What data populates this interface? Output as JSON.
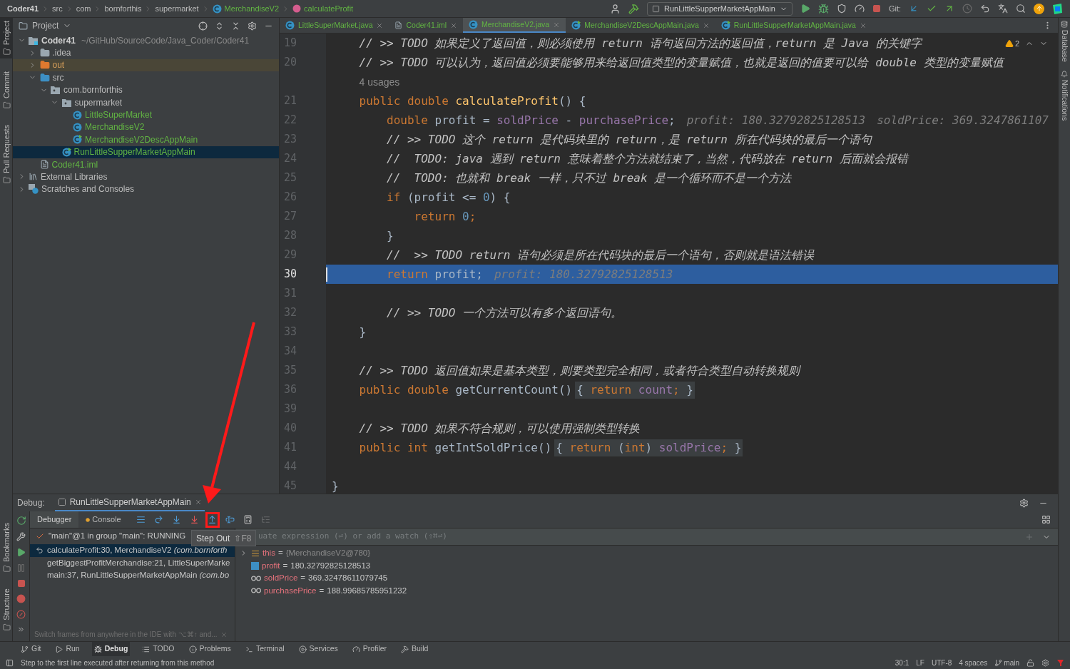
{
  "breadcrumbs": [
    {
      "kind": "project",
      "label": "Coder41"
    },
    {
      "kind": "dir",
      "label": "src"
    },
    {
      "kind": "dir",
      "label": "com"
    },
    {
      "kind": "dir",
      "label": "bornforthis"
    },
    {
      "kind": "dir",
      "label": "supermarket"
    },
    {
      "kind": "class",
      "label": "MerchandiseV2"
    },
    {
      "kind": "method",
      "label": "calculateProfit"
    }
  ],
  "run_config": "RunLittleSupperMarketAppMain",
  "git_label": "Git:",
  "left_strip": {
    "top": [
      {
        "label": "Project",
        "selected": true
      },
      {
        "label": "Commit",
        "selected": false
      },
      {
        "label": "Pull Requests",
        "selected": false
      }
    ],
    "bottom": [
      {
        "label": "Bookmarks",
        "selected": false
      },
      {
        "label": "Structure",
        "selected": false
      }
    ]
  },
  "right_strip": [
    {
      "kind": "database",
      "label": "Database"
    },
    {
      "kind": "notifications",
      "label": "Notifications"
    }
  ],
  "project": {
    "title": "Project",
    "tree": [
      {
        "kind": "module",
        "label": "Coder41",
        "path": "~/GitHub/SourceCode/Java_Coder/Coder41",
        "selected": false,
        "expanded": true,
        "children": [
          {
            "kind": "folder",
            "label": ".idea",
            "selected": false,
            "expanded": false
          },
          {
            "kind": "excluded",
            "label": "out",
            "selected": false,
            "expanded": false
          },
          {
            "kind": "source",
            "label": "src",
            "selected": false,
            "expanded": true,
            "children": [
              {
                "kind": "package",
                "label": "com.bornforthis",
                "selected": false,
                "expanded": true,
                "children": [
                  {
                    "kind": "package",
                    "label": "supermarket",
                    "selected": false,
                    "expanded": true,
                    "children": [
                      {
                        "kind": "class",
                        "label": "LittleSuperMarket",
                        "selected": false
                      },
                      {
                        "kind": "class",
                        "label": "MerchandiseV2",
                        "selected": false
                      },
                      {
                        "kind": "main_class",
                        "label": "MerchandiseV2DescAppMain",
                        "selected": false
                      }
                    ]
                  },
                  {
                    "kind": "main_class",
                    "label": "RunLittleSupperMarketAppMain",
                    "selected": true
                  }
                ]
              }
            ]
          },
          {
            "kind": "iml",
            "label": "Coder41.iml",
            "selected": false
          }
        ]
      },
      {
        "kind": "libraries",
        "label": "External Libraries",
        "selected": false,
        "expanded": false
      },
      {
        "kind": "scratches",
        "label": "Scratches and Consoles",
        "selected": false,
        "expanded": false
      }
    ]
  },
  "tabs": [
    {
      "kind": "class",
      "label": "LittleSuperMarket.java",
      "selected": false
    },
    {
      "kind": "iml",
      "label": "Coder41.iml",
      "selected": false
    },
    {
      "kind": "class",
      "label": "MerchandiseV2.java",
      "selected": true
    },
    {
      "kind": "main_class",
      "label": "MerchandiseV2DescAppMain.java",
      "selected": false
    },
    {
      "kind": "main_class",
      "label": "RunLittleSupperMarketAppMain.java",
      "selected": false
    }
  ],
  "editor": {
    "warnings": "2",
    "lines": [
      {
        "kind": "code",
        "number": "19",
        "current": false,
        "tokens": [
          {
            "kind": "comment",
            "text": "    // >> TODO 如果定义了返回值，则必须使用 return 语句返回方法的返回值，return 是 Java 的关键字"
          }
        ]
      },
      {
        "kind": "code",
        "number": "20",
        "current": false,
        "tokens": [
          {
            "kind": "comment",
            "text": "    // >> TODO 可以认为，返回值必须要能够用来给返回值类型的变量赋值，也就是返回的值要可以给 double 类型的变量赋值"
          }
        ]
      },
      {
        "kind": "usage",
        "text": "4 usages"
      },
      {
        "kind": "code",
        "number": "21",
        "current": false,
        "tokens": [
          {
            "kind": "kw",
            "text": "    public double "
          },
          {
            "kind": "fn",
            "text": "calculateProfit"
          },
          {
            "kind": "text",
            "text": "() {"
          }
        ]
      },
      {
        "kind": "code",
        "number": "22",
        "current": false,
        "tokens": [
          {
            "kind": "kw",
            "text": "        double "
          },
          {
            "kind": "text",
            "text": "profit = "
          },
          {
            "kind": "field",
            "text": "soldPrice"
          },
          {
            "kind": "text",
            "text": " - "
          },
          {
            "kind": "field",
            "text": "purchasePrice"
          },
          {
            "kind": "text",
            "text": ";"
          },
          {
            "kind": "hint",
            "text": "profit: 180.32792825128513"
          },
          {
            "kind": "hint",
            "text": "soldPrice: 369.3247861107"
          }
        ]
      },
      {
        "kind": "code",
        "number": "23",
        "current": false,
        "tokens": [
          {
            "kind": "comment",
            "text": "        // >> TODO 这个 return 是代码块里的 return，是 return 所在代码块的最后一个语句"
          }
        ]
      },
      {
        "kind": "code",
        "number": "24",
        "current": false,
        "tokens": [
          {
            "kind": "comment",
            "text": "        //  TODO: java 遇到 return 意味着整个方法就结束了，当然，代码放在 return 后面就会报错"
          }
        ]
      },
      {
        "kind": "code",
        "number": "25",
        "current": false,
        "tokens": [
          {
            "kind": "comment",
            "text": "        //  TODO: 也就和 break 一样，只不过 break 是一个循环而不是一个方法"
          }
        ]
      },
      {
        "kind": "code",
        "number": "26",
        "current": false,
        "tokens": [
          {
            "kind": "kw",
            "text": "        if "
          },
          {
            "kind": "text",
            "text": "(profit <= "
          },
          {
            "kind": "num",
            "text": "0"
          },
          {
            "kind": "text",
            "text": ") {"
          }
        ]
      },
      {
        "kind": "code",
        "number": "27",
        "current": false,
        "tokens": [
          {
            "kind": "kw",
            "text": "            return "
          },
          {
            "kind": "num",
            "text": "0"
          },
          {
            "kind": "kw",
            "text": ";"
          }
        ]
      },
      {
        "kind": "code",
        "number": "28",
        "current": false,
        "tokens": [
          {
            "kind": "text",
            "text": "        }"
          }
        ]
      },
      {
        "kind": "code",
        "number": "29",
        "current": false,
        "tokens": [
          {
            "kind": "comment",
            "text": "        //  >> TODO return 语句必须是所在代码块的最后一个语句，否则就是语法错误"
          }
        ]
      },
      {
        "kind": "code",
        "number": "30",
        "current": true,
        "tokens": [
          {
            "kind": "kw",
            "text": "        return "
          },
          {
            "kind": "text",
            "text": "profit;"
          },
          {
            "kind": "hint",
            "text": "profit: 180.32792825128513"
          }
        ]
      },
      {
        "kind": "code",
        "number": "31",
        "current": false
      },
      {
        "kind": "code",
        "number": "32",
        "current": false,
        "tokens": [
          {
            "kind": "comment",
            "text": "        // >> TODO 一个方法可以有多个返回语句。"
          }
        ]
      },
      {
        "kind": "code",
        "number": "33",
        "current": false,
        "tokens": [
          {
            "kind": "text",
            "text": "    }"
          }
        ]
      },
      {
        "kind": "code",
        "number": "34",
        "current": false
      },
      {
        "kind": "code",
        "number": "35",
        "current": false,
        "tokens": [
          {
            "kind": "comment",
            "text": "    // >> TODO 返回值如果是基本类型，则要类型完全相同，或者符合类型自动转换规则"
          }
        ]
      },
      {
        "kind": "code",
        "number": "36",
        "current": false,
        "tokens": [
          {
            "kind": "kw",
            "text": "    public double "
          },
          {
            "kind": "text",
            "text": "getCurrentCount()"
          }
        ],
        "fold": [
          {
            "kind": "text",
            "text": "{ "
          },
          {
            "kind": "kw",
            "text": "return "
          },
          {
            "kind": "field",
            "text": "count"
          },
          {
            "kind": "kw",
            "text": ";"
          },
          {
            "kind": "text",
            "text": " }"
          }
        ]
      },
      {
        "kind": "code",
        "number": "39",
        "current": false
      },
      {
        "kind": "code",
        "number": "40",
        "current": false,
        "tokens": [
          {
            "kind": "comment",
            "text": "    // >> TODO 如果不符合规则，可以使用强制类型转换"
          }
        ]
      },
      {
        "kind": "code",
        "number": "41",
        "current": false,
        "tokens": [
          {
            "kind": "kw",
            "text": "    public int "
          },
          {
            "kind": "text",
            "text": "getIntSoldPrice()"
          }
        ],
        "fold": [
          {
            "kind": "text",
            "text": "{ "
          },
          {
            "kind": "kw",
            "text": "return "
          },
          {
            "kind": "text",
            "text": "("
          },
          {
            "kind": "kw",
            "text": "int"
          },
          {
            "kind": "text",
            "text": ") "
          },
          {
            "kind": "field",
            "text": "soldPrice"
          },
          {
            "kind": "kw",
            "text": ";"
          },
          {
            "kind": "text",
            "text": " }"
          }
        ]
      },
      {
        "kind": "code",
        "number": "44",
        "current": false
      },
      {
        "kind": "code",
        "number": "45",
        "current": false,
        "tokens": [
          {
            "kind": "text",
            "text": "}"
          }
        ]
      }
    ]
  },
  "debug": {
    "label": "Debug:",
    "session": "RunLittleSupperMarketAppMain",
    "tabs": [
      {
        "kind": "debugger",
        "label": "Debugger",
        "selected": true
      },
      {
        "kind": "console",
        "label": "Console",
        "selected": false
      }
    ],
    "toolbar": [
      {
        "kind": "frames_menu",
        "highlighted": false,
        "disabled": false
      },
      {
        "kind": "step_over",
        "highlighted": false,
        "disabled": false
      },
      {
        "kind": "step_into",
        "highlighted": false,
        "disabled": false
      },
      {
        "kind": "force_step_into",
        "highlighted": false,
        "disabled": false
      },
      {
        "kind": "step_out",
        "highlighted": true,
        "disabled": false
      },
      {
        "kind": "run_to_cursor",
        "highlighted": false,
        "disabled": false
      },
      {
        "kind": "evaluate",
        "highlighted": false,
        "disabled": false
      },
      {
        "kind": "trace",
        "highlighted": false,
        "disabled": true
      }
    ],
    "tooltip": {
      "label": "Step Out",
      "shortcut": "⇧F8"
    },
    "thread": "\"main\"@1 in group \"main\": RUNNING",
    "frames": [
      {
        "text": "calculateProfit:30, MerchandiseV2 *(com.bornforth*",
        "selected": true
      },
      {
        "text": "getBiggestProfitMerchandise:21, LittleSuperMarke",
        "selected": false
      },
      {
        "text": "main:37, RunLittleSupperMarketAppMain *(com.bo*",
        "selected": false
      }
    ],
    "frames_hint": "Switch frames from anywhere in the IDE with ⌥⌘↑ and...",
    "watch_placeholder": "uate expression (⏎) or add a watch (⇧⌘⏎)",
    "variables": [
      {
        "kind": "object",
        "name": "this",
        "separator": "=",
        "value": "{MerchandiseV2@780}",
        "expanded": false
      },
      {
        "kind": "local",
        "name": "profit",
        "separator": "=",
        "value": "180.32792825128513"
      },
      {
        "kind": "field",
        "name": "soldPrice",
        "separator": "=",
        "value": "369.32478611079745"
      },
      {
        "kind": "field",
        "name": "purchasePrice",
        "separator": "=",
        "value": "188.99685785951232"
      }
    ]
  },
  "tool_tabs": [
    {
      "kind": "git",
      "label": "Git",
      "selected": false
    },
    {
      "kind": "run",
      "label": "Run",
      "selected": false
    },
    {
      "kind": "debug",
      "label": "Debug",
      "selected": true
    },
    {
      "kind": "todo",
      "label": "TODO",
      "selected": false
    },
    {
      "kind": "problems",
      "label": "Problems",
      "selected": false
    },
    {
      "kind": "terminal",
      "label": "Terminal",
      "selected": false
    },
    {
      "kind": "services",
      "label": "Services",
      "selected": false
    },
    {
      "kind": "profiler",
      "label": "Profiler",
      "selected": false
    },
    {
      "kind": "build",
      "label": "Build",
      "selected": false
    }
  ],
  "status_bar": {
    "message": "Step to the first line executed after returning from this method",
    "items": [
      "30:1",
      "LF",
      "UTF-8",
      "4 spaces"
    ],
    "branch": "main"
  }
}
